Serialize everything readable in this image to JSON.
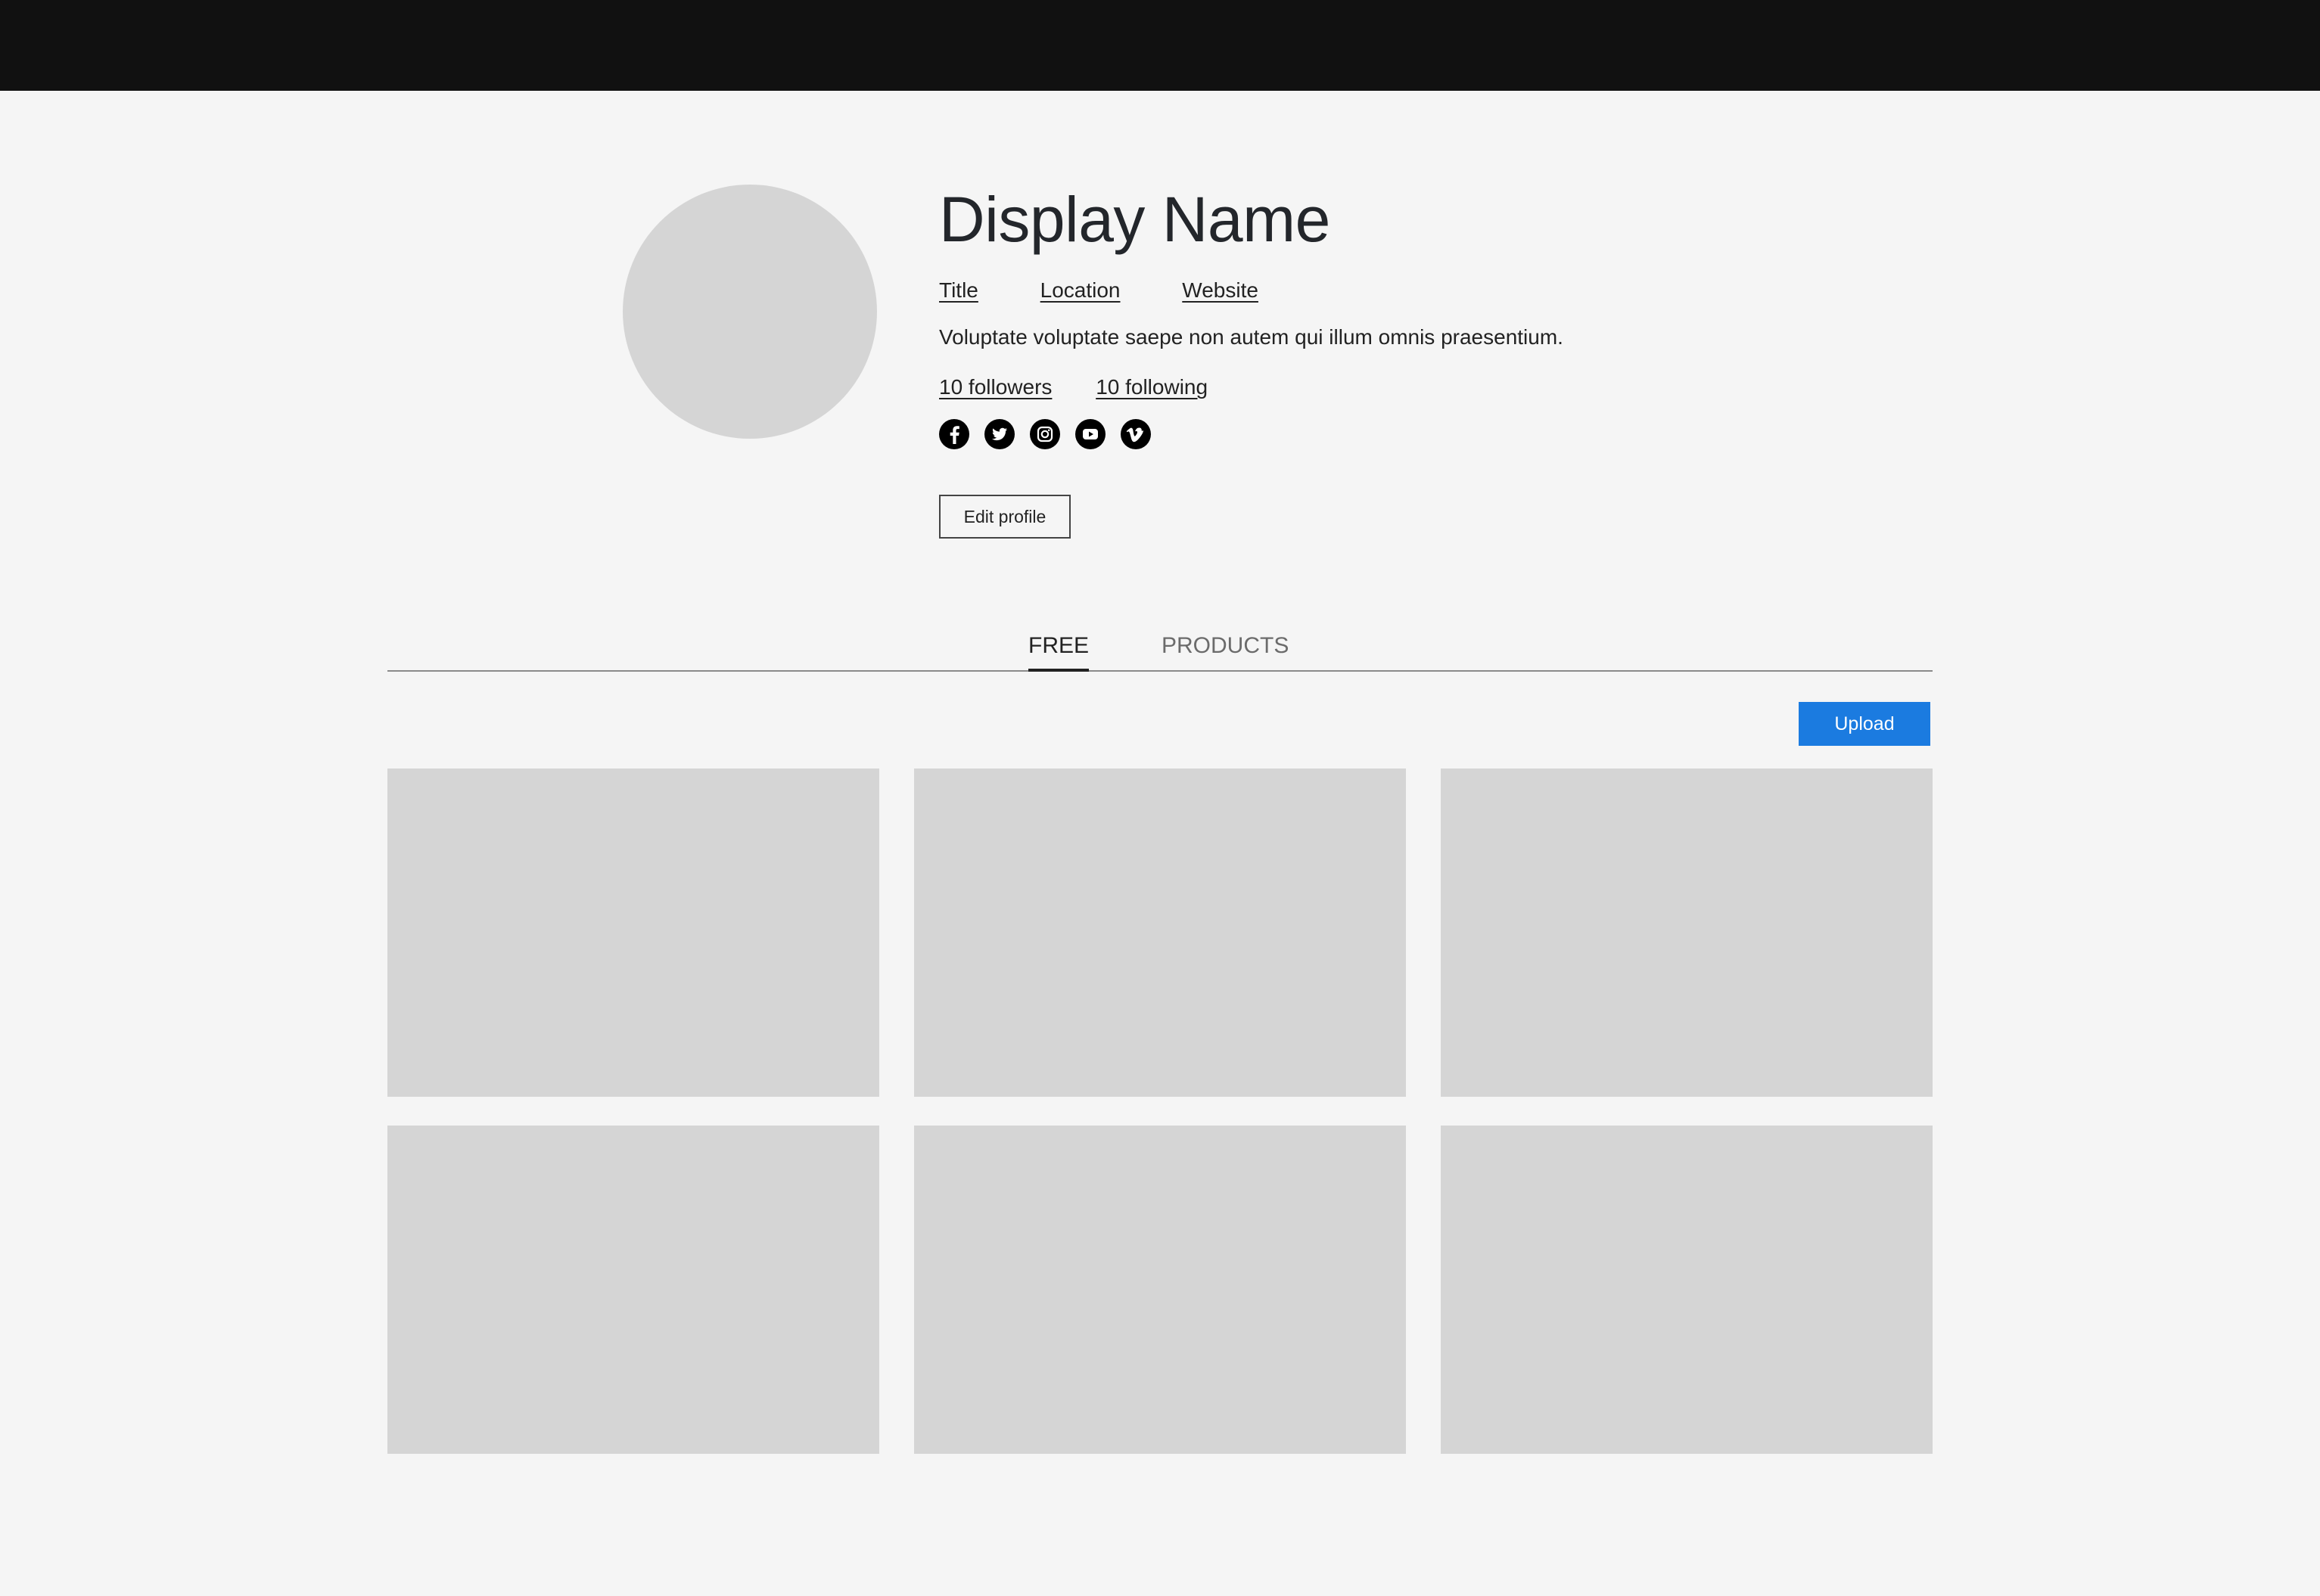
{
  "profile": {
    "display_name": "Display Name",
    "links": {
      "title": "Title",
      "location": "Location",
      "website": "Website"
    },
    "bio": "Voluptate voluptate saepe non autem qui illum omnis praesentium.",
    "followers": "10 followers",
    "following": "10 following",
    "social_icons": [
      "facebook-icon",
      "twitter-icon",
      "instagram-icon",
      "youtube-icon",
      "vimeo-icon"
    ],
    "edit_button": "Edit profile"
  },
  "tabs": [
    {
      "label": "FREE",
      "active": true
    },
    {
      "label": "PRODUCTS",
      "active": false
    }
  ],
  "upload_button": "Upload",
  "colors": {
    "topbar": "#111111",
    "background": "#f5f5f5",
    "placeholder": "#d5d5d5",
    "accent": "#1b7be0"
  }
}
